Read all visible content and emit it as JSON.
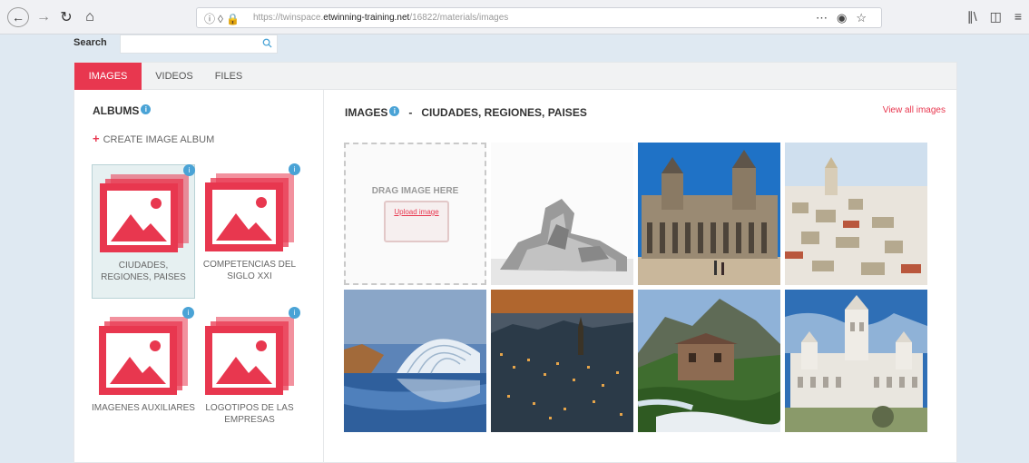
{
  "browser": {
    "url_prefix": "https://twinspace.",
    "url_host": "etwinning-training.net",
    "url_path": "/16822/materials/images",
    "more_icon": "ellipsis-icon",
    "pocket_icon": "pocket-icon",
    "bookmark_icon": "star-icon"
  },
  "search": {
    "label": "Search",
    "placeholder": ""
  },
  "tabs": [
    {
      "label": "IMAGES",
      "active": true
    },
    {
      "label": "VIDEOS",
      "active": false
    },
    {
      "label": "FILES",
      "active": false
    }
  ],
  "albums": {
    "title": "ALBUMS",
    "info": "i",
    "create_label": "CREATE IMAGE ALBUM",
    "items": [
      {
        "name": "CIUDADES, REGIONES, PAISES",
        "selected": true,
        "badge": "i"
      },
      {
        "name": "COMPETENCIAS DEL SIGLO XXI",
        "selected": false,
        "badge": "i"
      },
      {
        "name": "IMAGENES AUXILIARES",
        "selected": false,
        "badge": "i"
      },
      {
        "name": "LOGOTIPOS DE LAS EMPRESAS",
        "selected": false,
        "badge": "i"
      }
    ]
  },
  "images": {
    "title": "IMAGES",
    "dash": "-",
    "album_name": "CIUDADES, REGIONES, PAISES",
    "view_all": "View all images",
    "drag_text": "DRAG IMAGE HERE",
    "upload_link": "Upload image",
    "thumbnails": [
      "modern-museum-photo",
      "town-hall-square-photo",
      "whitewashed-coastal-city-photo",
      "futuristic-architecture-photo",
      "city-at-dusk-photo",
      "mountain-village-photo",
      "white-palace-photo"
    ]
  },
  "colors": {
    "accent": "#e8374f",
    "info": "#4aa3d6"
  }
}
